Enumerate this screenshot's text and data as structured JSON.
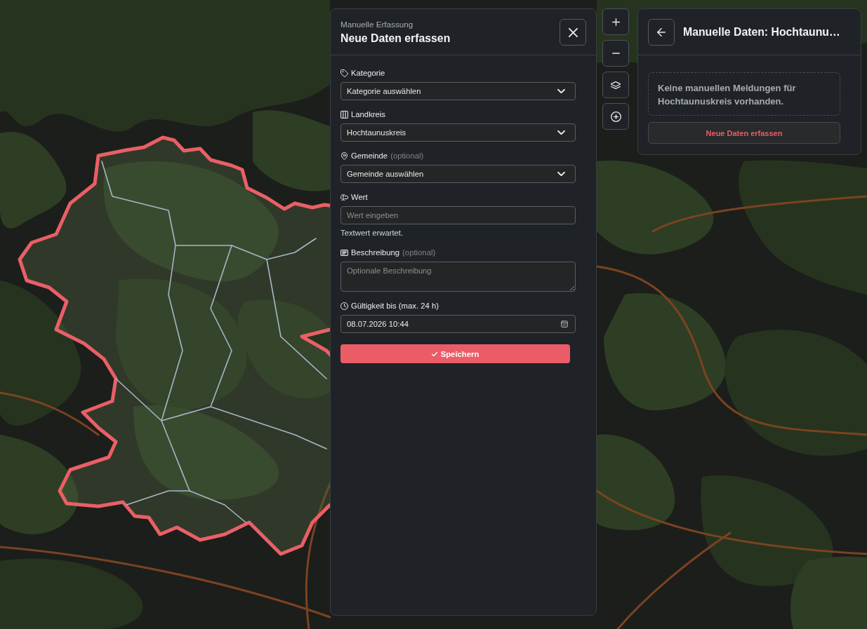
{
  "form_panel": {
    "subtitle": "Manuelle Erfassung",
    "title": "Neue Daten erfassen",
    "fields": [
      {
        "kind": "select",
        "label": "Kategorie",
        "value": "Kategorie auswählen"
      },
      {
        "kind": "select",
        "label": "Landkreis",
        "value": "Hochtaunuskreis"
      },
      {
        "kind": "select",
        "label": "Gemeinde",
        "optional_note": "(optional)",
        "value": "Gemeinde auswählen"
      },
      {
        "kind": "text",
        "label": "Wert",
        "placeholder": "Wert eingeben",
        "hint": "Textwert erwartet."
      },
      {
        "kind": "textarea",
        "label": "Beschreibung",
        "optional_note": "(optional)",
        "placeholder": "Optionale Beschreibung"
      },
      {
        "kind": "datetime",
        "label": "Gültigkeit bis (max. 24 h)",
        "value": "08.07.2026 10:44"
      }
    ],
    "submit_button": "Speichern"
  },
  "info_panel": {
    "title": "Manuelle Daten: Hochtaunu…",
    "empty_message": "Keine manuellen Meldungen für Hochtaunuskreis vorhanden.",
    "action_button": "Neue Daten erfassen"
  }
}
